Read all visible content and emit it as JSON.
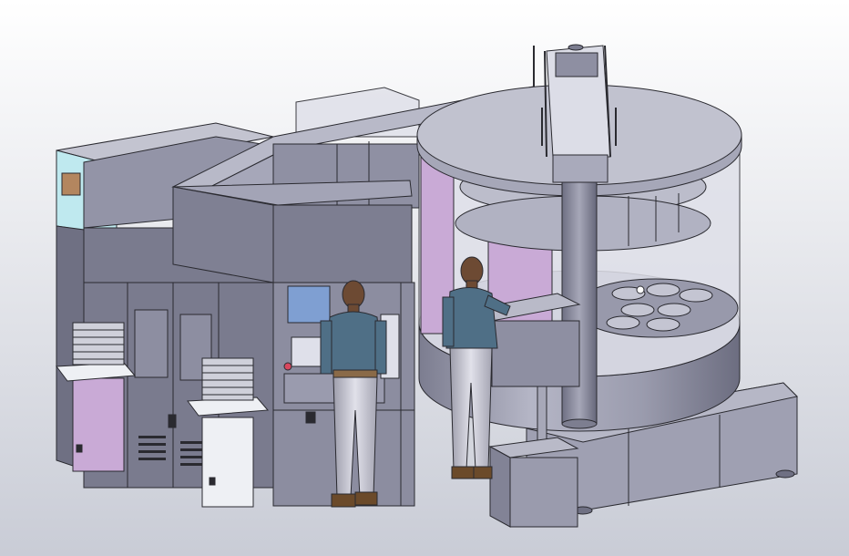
{
  "scene": {
    "background_top": "#ffffff",
    "background_bottom": "#c9ccd6",
    "colors": {
      "panel_dark": "#6f7083",
      "panel_mid": "#8d8ea1",
      "panel_light": "#a9aabb",
      "panel_top": "#b9bac8",
      "lavender": "#c9aad6",
      "glass": "#dcdde6",
      "outline": "#2a2a30",
      "screen_blue": "#7f9fd2",
      "copper": "#b3865f",
      "cyan_panel": "#bfe9ef",
      "white_part": "#eef0f4",
      "jacket": "#4f6f86",
      "pants": "#c9c9d3",
      "skin": "#6d4a33",
      "boots": "#6b4a2a"
    }
  }
}
